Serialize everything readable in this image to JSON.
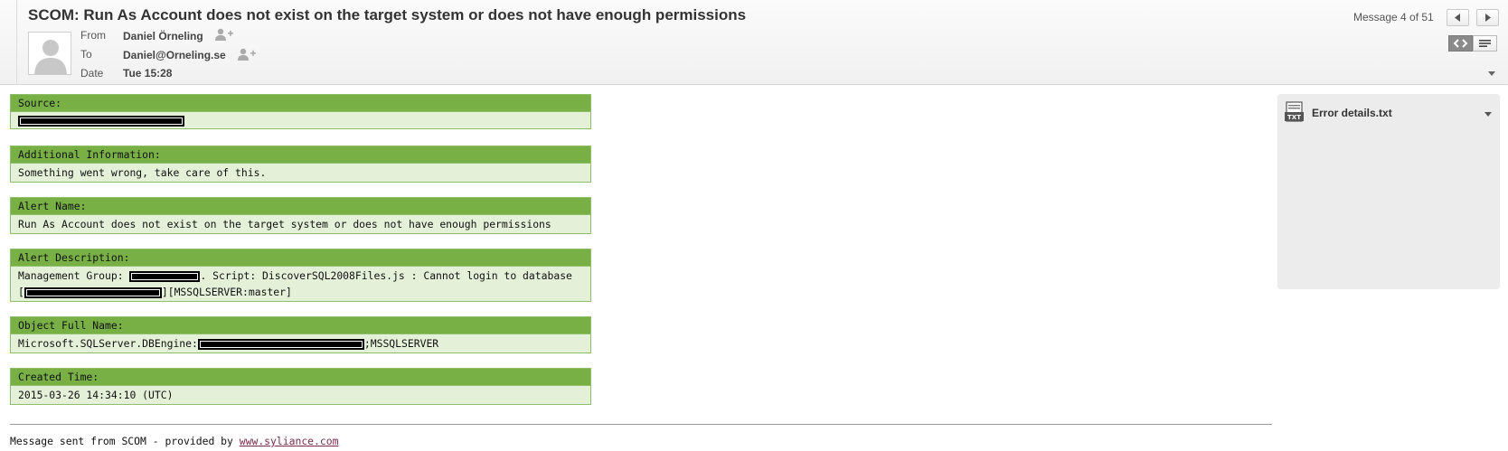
{
  "header": {
    "subject": "SCOM: Run As Account does not exist on the target system or does not have enough permissions",
    "from_label": "From",
    "from_value": "Daniel Örneling",
    "to_label": "To",
    "to_value": "Daniel@Orneling.se",
    "date_label": "Date",
    "date_value": "Tue 15:28",
    "message_counter": "Message 4 of 51",
    "icons": [
      "avatar-placeholder",
      "add-contact-icon",
      "prev-arrow-icon",
      "next-arrow-icon",
      "html-view-icon",
      "plain-text-view-icon",
      "expand-arrow-icon"
    ]
  },
  "sections": [
    {
      "title": "Source:",
      "lines": [
        [
          {
            "redacted": true
          }
        ]
      ]
    },
    {
      "title": "Additional Information:",
      "lines": [
        [
          {
            "text": "Something went wrong, take care of this."
          }
        ]
      ]
    },
    {
      "title": "Alert Name:",
      "lines": [
        [
          {
            "text": "Run As Account does not exist on the target system or does not have enough permissions"
          }
        ]
      ]
    },
    {
      "title": "Alert Description:",
      "lines": [
        [
          {
            "text": "Management Group: "
          },
          {
            "redacted": true
          },
          {
            "text": ". Script: DiscoverSQL2008Files.js : Cannot login to database"
          }
        ],
        [
          {
            "text": "["
          },
          {
            "redacted": true
          },
          {
            "text": "][MSSQLSERVER:master]"
          }
        ]
      ]
    },
    {
      "title": "Object Full Name:",
      "lines": [
        [
          {
            "text": "Microsoft.SQLServer.DBEngine:"
          },
          {
            "redacted": true
          },
          {
            "text": ";MSSQLSERVER"
          }
        ]
      ]
    },
    {
      "title": "Created Time:",
      "lines": [
        [
          {
            "text": "2015-03-26 14:34:10 (UTC)"
          }
        ]
      ]
    }
  ],
  "footer": {
    "prefix": "Message sent from SCOM - provided by ",
    "link_text": "www.syliance.com"
  },
  "attachment": {
    "filename": "Error details.txt",
    "icon_label": "TXT"
  },
  "colors": {
    "section_header": "#78b046",
    "section_body": "#e4f0d8",
    "footer_link": "#7b2a4c"
  }
}
